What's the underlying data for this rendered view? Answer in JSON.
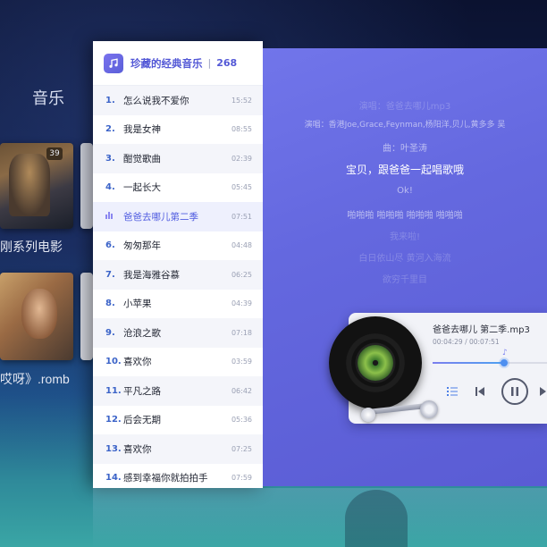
{
  "background": {
    "section_label": "音乐",
    "thumb1_badge": "39",
    "caption1": "刚系列电影",
    "caption2": "哎呀》.romb"
  },
  "playlist": {
    "title": "珍藏的经典音乐",
    "separator": "|",
    "count": "268",
    "icon": "music-note-icon",
    "tracks": [
      {
        "num": "1.",
        "title": "怎么说我不爱你",
        "duration": "15:52"
      },
      {
        "num": "2.",
        "title": "我是女神",
        "duration": "08:55"
      },
      {
        "num": "3.",
        "title": "酣觉歌曲",
        "duration": "02:39"
      },
      {
        "num": "4.",
        "title": "一起长大",
        "duration": "05:45"
      },
      {
        "num": "",
        "title": "爸爸去哪儿第二季",
        "duration": "07:51",
        "active": true
      },
      {
        "num": "6.",
        "title": "匆匆那年",
        "duration": "04:48"
      },
      {
        "num": "7.",
        "title": "我是海雅谷慕",
        "duration": "06:25"
      },
      {
        "num": "8.",
        "title": "小苹果",
        "duration": "04:39"
      },
      {
        "num": "9.",
        "title": "沧浪之歌",
        "duration": "07:18"
      },
      {
        "num": "10.",
        "title": "喜欢你",
        "duration": "03:59"
      },
      {
        "num": "11.",
        "title": "平凡之路",
        "duration": "06:42"
      },
      {
        "num": "12.",
        "title": "后会无期",
        "duration": "05:36"
      },
      {
        "num": "13.",
        "title": "喜欢你",
        "duration": "07:25"
      },
      {
        "num": "14.",
        "title": "感到幸福你就拍拍手",
        "duration": "07:59"
      }
    ]
  },
  "lyrics": {
    "line1": "演唱：爸爸去哪儿mp3",
    "line2": "演唱：香港Joe,Grace,Feynman,杨阳洋,贝儿,黄多多 吴",
    "line3": "曲：叶圣涛",
    "current": "宝贝，跟爸爸一起唱歌哦",
    "line5": "Ok!",
    "line6": "啪啪啪 啪啪啪 啪啪啪 啪啪啪",
    "line7": "我来啦!",
    "line8": "白日依山尽 黄河入海流",
    "line9": "欲穷千里目"
  },
  "player": {
    "track_title": "爸爸去哪儿 第二季.mp3",
    "time": "00:04:29 / 00:07:51",
    "progress": 0.6,
    "note_icon": "music-note-icon",
    "accent": "#4e8ff0"
  },
  "colors": {
    "panel_accent": "#6468df",
    "list_accent": "#5358d6"
  }
}
